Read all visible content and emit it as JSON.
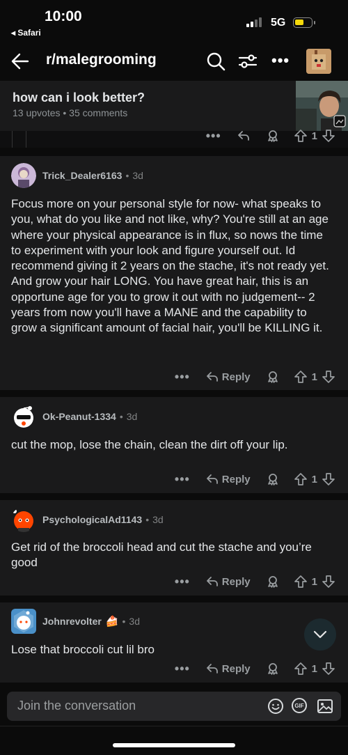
{
  "status": {
    "time": "10:00",
    "back_app": "◂ Safari",
    "network": "5G"
  },
  "nav": {
    "subreddit": "r/malegrooming"
  },
  "post": {
    "title": "how can i look better?",
    "meta": "13 upvotes • 35 comments"
  },
  "icons": {
    "back": "arrow-left-icon",
    "search": "search-icon",
    "filter": "filter-icon",
    "more": "more-horizontal-icon",
    "reply": "reply-icon",
    "award": "award-icon",
    "upvote": "upvote-icon",
    "downvote": "downvote-icon",
    "emoji": "emoji-icon",
    "gif": "gif-icon",
    "image": "image-icon",
    "scroll_down": "chevron-down-icon"
  },
  "colors": {
    "background": "#0b0b0b",
    "card": "#1a1a1b",
    "text": "#e4e6e8",
    "muted": "#818384",
    "accent_scroll": "#1c2a2f"
  },
  "top_strip": {
    "more": "•••",
    "count": "1"
  },
  "comments": [
    {
      "username": "Trick_Dealer6163",
      "age": "3d",
      "body": "Focus more on your personal style for now- what speaks to you, what do you like and not like, why? You're still at an age where your physical appearance is in flux, so nows the time to experiment with your look and figure yourself out. Id recommend giving it 2 years on the stache, it's not ready yet. And grow your hair LONG. You have great hair, this is an opportune age for you to grow it out with no judgement-- 2 years from now you'll have a MANE and the capability to grow a significant amount of facial hair, you'll be KILLING it.",
      "more": "•••",
      "reply": "Reply",
      "votes": "1"
    },
    {
      "username": "Ok-Peanut-1334",
      "age": "3d",
      "body": "cut the mop, lose the chain, clean the dirt off your lip.",
      "more": "•••",
      "reply": "Reply",
      "votes": "1"
    },
    {
      "username": "PsychologicalAd1143",
      "age": "3d",
      "body": "Get rid of the broccoli head and cut the stache and you’re good",
      "more": "•••",
      "reply": "Reply",
      "votes": "1"
    },
    {
      "username": "Johnrevolter",
      "flair": "🍰",
      "age": "3d",
      "body": "Lose that broccoli cut lil bro",
      "more": "•••",
      "reply": "Reply",
      "votes": "1"
    }
  ],
  "composer": {
    "placeholder": "Join the conversation",
    "gif_label": "GIF"
  }
}
